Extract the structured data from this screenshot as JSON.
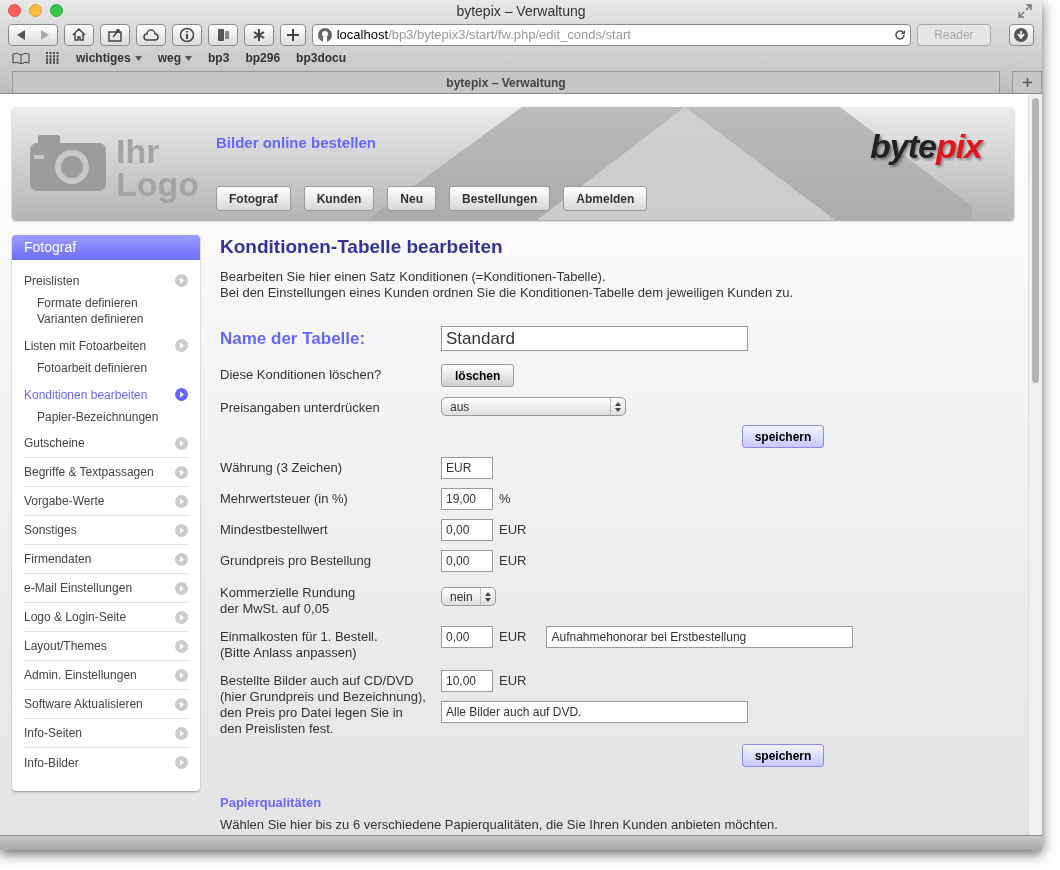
{
  "window": {
    "title": "bytepix – Verwaltung"
  },
  "toolbar": {
    "url_host": "localhost",
    "url_path": "/bp3/bytepix3/start/fw.php/edit_conds/start",
    "reader": "Reader"
  },
  "bookmarks": [
    {
      "label": "wichtiges",
      "menu": true
    },
    {
      "label": "weg",
      "menu": true
    },
    {
      "label": "bp3",
      "menu": false
    },
    {
      "label": "bp296",
      "menu": false
    },
    {
      "label": "bp3docu",
      "menu": false
    }
  ],
  "tab": {
    "title": "bytepix – Verwaltung"
  },
  "header": {
    "logo_line_1": "Ihr",
    "logo_line_2": "Logo",
    "tagline": "Bilder online bestellen",
    "brand_first": "byte",
    "brand_second": "pix",
    "nav": [
      "Fotograf",
      "Kunden",
      "Neu",
      "Bestellungen",
      "Abmelden"
    ]
  },
  "sidebar": {
    "title": "Fotograf",
    "items": [
      {
        "label": "Preislisten",
        "selected": false,
        "children": [
          {
            "label": "Formate definieren"
          },
          {
            "label": "Varianten definieren"
          }
        ]
      },
      {
        "label": "Listen mit Fotoarbeiten",
        "selected": false,
        "children": [
          {
            "label": "Fotoarbeit definieren"
          }
        ]
      },
      {
        "label": "Konditionen bearbeiten",
        "selected": true,
        "children": [
          {
            "label": "Papier-Bezeichnungen"
          }
        ]
      },
      {
        "label": "Gutscheine",
        "selected": false
      },
      {
        "label": "Begriffe & Textpassagen",
        "selected": false
      },
      {
        "label": "Vorgabe-Werte",
        "selected": false
      },
      {
        "label": "Sonstiges",
        "selected": false
      },
      {
        "label": "Firmendaten",
        "selected": false
      },
      {
        "label": "e-Mail Einstellungen",
        "selected": false
      },
      {
        "label": "Logo & Login-Seite",
        "selected": false
      },
      {
        "label": "Layout/Themes",
        "selected": false
      },
      {
        "label": "Admin. Einstellungen",
        "selected": false
      },
      {
        "label": "Software Aktualisieren",
        "selected": false
      },
      {
        "label": "Info-Seiten",
        "selected": false
      },
      {
        "label": "Info-Bilder",
        "selected": false
      }
    ]
  },
  "main": {
    "heading": "Konditionen-Tabelle bearbeiten",
    "intro": [
      "Bearbeiten Sie hier einen Satz Konditionen (=Konditionen-Tabelle).",
      "Bei den Einstellungen eines Kunden ordnen Sie die Konditionen-Tabelle dem jeweiligen Kunden zu."
    ],
    "name_label": "Name der Tabelle:",
    "name_value": "Standard",
    "rows": [
      {
        "kind": "button",
        "label": [
          "Diese Konditionen löschen?"
        ],
        "button": "löschen"
      },
      {
        "kind": "select",
        "label": [
          "Preisangaben unterdrücken"
        ],
        "value": "aus",
        "wide": true
      },
      {
        "kind": "save",
        "button": "speichern"
      },
      {
        "kind": "input",
        "label": [
          "Währung (3 Zeichen)"
        ],
        "value": "EUR"
      },
      {
        "kind": "input",
        "label": [
          "Mehrwertsteuer (in %)"
        ],
        "value": "19,00",
        "unit": "%"
      },
      {
        "kind": "input",
        "label": [
          "Mindestbestellwert"
        ],
        "value": "0,00",
        "unit": "EUR"
      },
      {
        "kind": "input",
        "label": [
          "Grundpreis pro Bestellung"
        ],
        "value": "0,00",
        "unit": "EUR"
      },
      {
        "kind": "select",
        "label": [
          "Kommerzielle Rundung",
          "der MwSt. auf 0,05"
        ],
        "value": "nein",
        "wide": false
      },
      {
        "kind": "input",
        "label": [
          "Einmalkosten für 1. Bestell.",
          "(Bitte Anlass anpassen)"
        ],
        "value": "0,00",
        "unit": "EUR",
        "note": "Aufnahmehonorar bei Erstbestellung"
      },
      {
        "kind": "input",
        "label": [
          "Bestellte Bilder auch auf CD/DVD",
          "(hier Grundpreis und Bezeichnung),",
          "den Preis pro Datei legen Sie in",
          "den Preislisten fest."
        ],
        "value": "10,00",
        "unit": "EUR",
        "note_below": "Alle Bilder auch auf DVD."
      },
      {
        "kind": "save",
        "button": "speichern"
      }
    ],
    "section_title": "Papierqualitäten",
    "section_text": "Wählen Sie hier bis zu 6 verschiedene Papierqualitäten, die Sie Ihren Kunden anbieten möchten."
  }
}
